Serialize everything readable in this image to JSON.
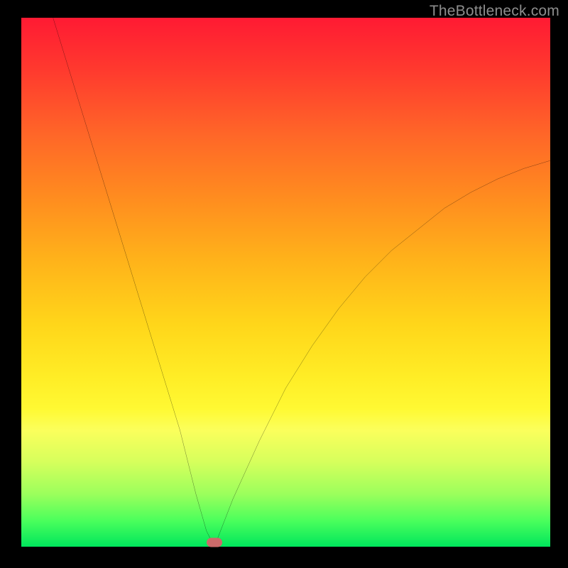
{
  "watermark": "TheBottleneck.com",
  "chart_data": {
    "type": "line",
    "title": "",
    "xlabel": "",
    "ylabel": "",
    "xlim": [
      0,
      100
    ],
    "ylim": [
      0,
      100
    ],
    "grid": false,
    "legend": false,
    "background_gradient": {
      "top_color": "#ff1a33",
      "bottom_color": "#00e65c",
      "description": "vertical red-to-green gradient (red=high bottleneck, green=low bottleneck)"
    },
    "series": [
      {
        "name": "bottleneck-curve",
        "color": "#000000",
        "x": [
          6,
          10,
          14,
          18,
          22,
          26,
          30,
          33,
          35,
          36.5,
          40,
          45,
          50,
          55,
          60,
          65,
          70,
          75,
          80,
          85,
          90,
          95,
          100
        ],
        "y": [
          100,
          87,
          74,
          61,
          48,
          35,
          22,
          10,
          3,
          0,
          9,
          20,
          30,
          38,
          45,
          51,
          56,
          60,
          64,
          67,
          69.5,
          71.5,
          73
        ]
      }
    ],
    "marker": {
      "name": "optimal-point",
      "x": 36.5,
      "y": 0.8,
      "color": "#cc6a6a"
    }
  }
}
